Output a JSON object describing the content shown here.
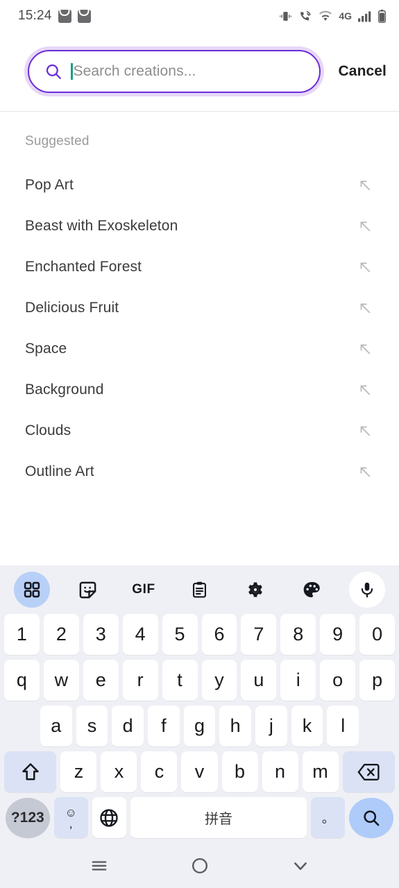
{
  "status_bar": {
    "time": "15:24",
    "left_icons": [
      "shopping-bag-icon",
      "shopping-bag-icon"
    ],
    "network_label": "4G",
    "right_icons": [
      "vibrate-icon",
      "call-signal-icon",
      "wifi-icon",
      "signal-bars-icon",
      "battery-icon"
    ]
  },
  "search": {
    "placeholder": "Search creations...",
    "value": "",
    "icon": "search-icon",
    "cancel_label": "Cancel",
    "border_color": "#6c2bd9",
    "icon_color": "#6c2bd9",
    "caret_color": "#16a085"
  },
  "suggestions": {
    "section_title": "Suggested",
    "items": [
      {
        "label": "Pop Art",
        "action_icon": "arrow-up-left-icon"
      },
      {
        "label": "Beast with Exoskeleton",
        "action_icon": "arrow-up-left-icon"
      },
      {
        "label": "Enchanted Forest",
        "action_icon": "arrow-up-left-icon"
      },
      {
        "label": "Delicious Fruit",
        "action_icon": "arrow-up-left-icon"
      },
      {
        "label": "Space",
        "action_icon": "arrow-up-left-icon"
      },
      {
        "label": "Background",
        "action_icon": "arrow-up-left-icon"
      },
      {
        "label": "Clouds",
        "action_icon": "arrow-up-left-icon"
      },
      {
        "label": "Outline Art",
        "action_icon": "arrow-up-left-icon"
      }
    ]
  },
  "keyboard": {
    "toolbar": [
      {
        "name": "grid-icon",
        "label": "",
        "active": true
      },
      {
        "name": "sticker-icon",
        "label": "",
        "active": false
      },
      {
        "name": "gif-icon",
        "label": "GIF",
        "active": false
      },
      {
        "name": "clipboard-icon",
        "label": "",
        "active": false
      },
      {
        "name": "gear-icon",
        "label": "",
        "active": false
      },
      {
        "name": "palette-icon",
        "label": "",
        "active": false
      },
      {
        "name": "microphone-icon",
        "label": "",
        "active": false
      }
    ],
    "row_numbers": [
      "1",
      "2",
      "3",
      "4",
      "5",
      "6",
      "7",
      "8",
      "9",
      "0"
    ],
    "row_top": [
      "q",
      "w",
      "e",
      "r",
      "t",
      "y",
      "u",
      "i",
      "o",
      "p"
    ],
    "row_home": [
      "a",
      "s",
      "d",
      "f",
      "g",
      "h",
      "j",
      "k",
      "l"
    ],
    "row_bottom": [
      "z",
      "x",
      "c",
      "v",
      "b",
      "n",
      "m"
    ],
    "shift_icon": "shift-icon",
    "backspace_icon": "backspace-icon",
    "symbols_label": "?123",
    "emoji_key_top": "☺",
    "emoji_key_bottom": ",",
    "globe_icon": "globe-icon",
    "space_label": "拼音",
    "period_label": "。",
    "enter_icon": "search-icon",
    "key_bg": "#ffffff",
    "func_key_bg": "#dbe2f6",
    "enter_key_bg": "#aecbfa",
    "keyboard_bg": "#eff0f5"
  },
  "nav_bar": {
    "recents_icon": "menu-icon",
    "home_icon": "circle-icon",
    "dismiss_icon": "chevron-down-icon"
  }
}
